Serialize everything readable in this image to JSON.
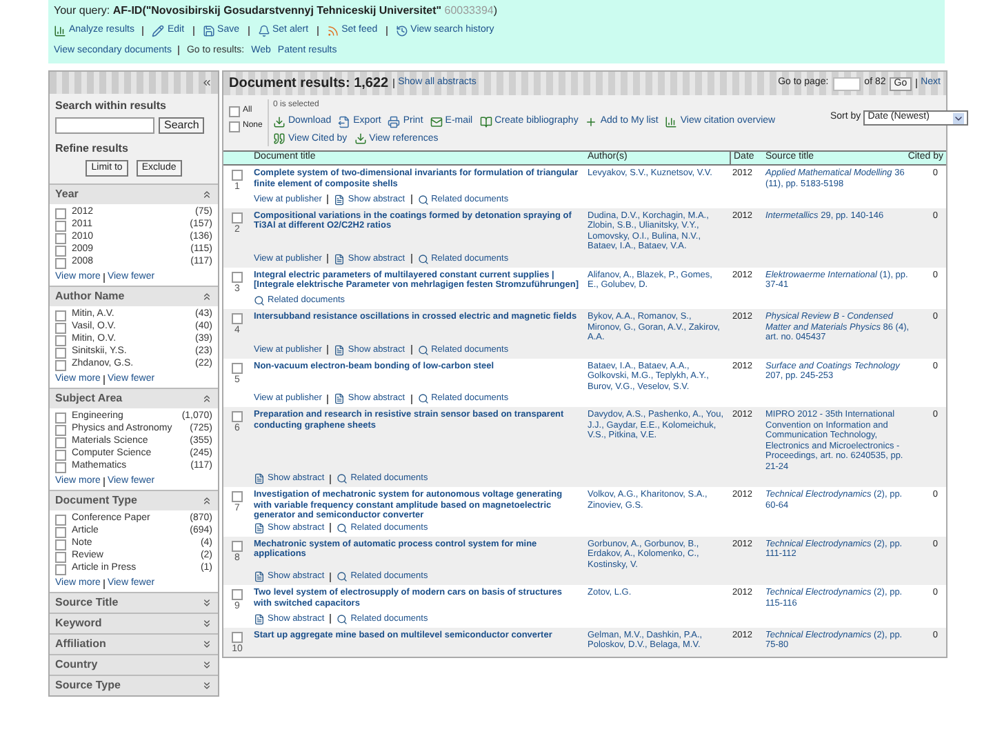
{
  "query": {
    "label": "Your query:",
    "text": "AF-ID(\"Novosibirskij Gosudarstvennyj Tehniceskij Universitet\" ",
    "id": "60033394",
    "close": ")"
  },
  "header_tools": [
    {
      "kind": "chart",
      "label": "Analyze results"
    },
    {
      "kind": "edit",
      "label": "Edit"
    },
    {
      "kind": "save",
      "label": "Save"
    },
    {
      "kind": "alert",
      "label": "Set alert"
    },
    {
      "kind": "feed",
      "label": "Set feed"
    },
    {
      "kind": "history",
      "label": "View search history"
    }
  ],
  "header_links": [
    {
      "label": "View secondary documents"
    },
    {
      "label": "Go to results:"
    },
    {
      "label": "Web"
    },
    {
      "label": "Patent results"
    }
  ],
  "sidebar": {
    "search_label": "Search within results",
    "search_button": "Search",
    "refine_label": "Refine results",
    "limit_button": "Limit to",
    "exclude_button": "Exclude",
    "facets": [
      {
        "title": "Year",
        "expanded": true,
        "items": [
          {
            "label": "2012",
            "count": "(75)",
            "checked": false
          },
          {
            "label": "2011",
            "count": "(157)",
            "checked": false
          },
          {
            "label": "2010",
            "count": "(136)",
            "checked": false
          },
          {
            "label": "2009",
            "count": "(115)",
            "checked": false
          },
          {
            "label": "2008",
            "count": "(117)",
            "checked": false
          }
        ],
        "more": "View more",
        "fewer": "View fewer"
      },
      {
        "title": "Author Name",
        "expanded": true,
        "items": [
          {
            "label": "Mitin, A.V.",
            "count": "(43)",
            "checked": false
          },
          {
            "label": "Vasil, O.V.",
            "count": "(40)",
            "checked": false
          },
          {
            "label": "Mitin, O.V.",
            "count": "(39)",
            "checked": false
          },
          {
            "label": "Sinitskii, Y.S.",
            "count": "(23)",
            "checked": false
          },
          {
            "label": "Zhdanov, G.S.",
            "count": "(22)",
            "checked": false
          }
        ],
        "more": "View more",
        "fewer": "View fewer"
      },
      {
        "title": "Subject Area",
        "expanded": true,
        "items": [
          {
            "label": "Engineering",
            "count": "(1,070)",
            "checked": false
          },
          {
            "label": "Physics and Astronomy",
            "count": "(725)",
            "checked": false
          },
          {
            "label": "Materials Science",
            "count": "(355)",
            "checked": false
          },
          {
            "label": "Computer Science",
            "count": "(245)",
            "checked": false
          },
          {
            "label": "Mathematics",
            "count": "(117)",
            "checked": false
          }
        ],
        "more": "View more",
        "fewer": "View fewer"
      },
      {
        "title": "Document Type",
        "expanded": true,
        "items": [
          {
            "label": "Conference Paper",
            "count": "(870)",
            "checked": false
          },
          {
            "label": "Article",
            "count": "(694)",
            "checked": false
          },
          {
            "label": "Note",
            "count": "(4)",
            "checked": false
          },
          {
            "label": "Review",
            "count": "(2)",
            "checked": false
          },
          {
            "label": "Article in Press",
            "count": "(1)",
            "checked": false
          }
        ],
        "more": "View more",
        "fewer": "View fewer"
      },
      {
        "title": "Source Title",
        "expanded": false
      },
      {
        "title": "Keyword",
        "expanded": false
      },
      {
        "title": "Affiliation",
        "expanded": false
      },
      {
        "title": "Country",
        "expanded": false
      },
      {
        "title": "Source Type",
        "expanded": false
      }
    ]
  },
  "results": {
    "title": "Document results: 1,622",
    "show_all": "Show all abstracts",
    "goto_label": "Go to page:",
    "of_pages": "of 82",
    "go_button": "Go",
    "next_link": "Next",
    "select_all": "All",
    "select_none": "None",
    "select_all_checked": false,
    "select_none_checked": false,
    "selected_count": "0 is selected",
    "actions": [
      {
        "kind": "download",
        "label": "Download"
      },
      {
        "kind": "export",
        "label": "Export"
      },
      {
        "kind": "print",
        "label": "Print"
      },
      {
        "kind": "email",
        "label": "E-mail"
      },
      {
        "kind": "biblio",
        "label": "Create bibliography"
      },
      {
        "kind": "add",
        "label": "Add to My list"
      },
      {
        "kind": "chart",
        "label": "View citation overview"
      },
      {
        "kind": "cited",
        "label": "View Cited by"
      },
      {
        "kind": "download",
        "label": "View references"
      }
    ],
    "sort_label": "Sort by",
    "sort_value": "Date (Newest)",
    "columns": [
      "Document title",
      "Author(s)",
      "Date",
      "Source title",
      "Cited by"
    ],
    "rows": [
      {
        "number": "1",
        "checked": false,
        "title": "Complete system of two-dimensional invariants for formulation of triangular finite element of composite shells",
        "authors": "Levyakov, S.V., Kuznetsov, V.V.",
        "date": "2012",
        "source": "*Applied Mathematical Modelling* 36 (11), pp. 5183-5198",
        "cited": "0",
        "links": [
          {
            "kind": "publisher",
            "label": "View at publisher"
          },
          {
            "kind": "abstract",
            "label": "Show abstract"
          },
          {
            "kind": "related",
            "label": "Related documents"
          }
        ]
      },
      {
        "number": "2",
        "checked": false,
        "title": "Compositional variations in the coatings formed by detonation spraying of Ti3Al at different O2/C2H2 ratios",
        "authors": "Dudina, D.V., Korchagin, M.A., Zlobin, S.B., Ulianitsky, V.Y., Lomovsky, O.I., Bulina, N.V., Bataev, I.A., Bataev, V.A.",
        "date": "2012",
        "source": "*Intermetallics* 29, pp. 140-146",
        "cited": "0",
        "links": [
          {
            "kind": "publisher",
            "label": "View at publisher"
          },
          {
            "kind": "abstract",
            "label": "Show abstract"
          },
          {
            "kind": "related",
            "label": "Related documents"
          }
        ]
      },
      {
        "number": "3",
        "checked": false,
        "title": "Integral electric parameters of multilayered constant current supplies | [Integrale elektrische Parameter von mehrlagigen festen Stromzuführungen]",
        "authors": "Alifanov, A., Blazek, P., Gomes, E., Golubev, D.",
        "date": "2012",
        "source": "*Elektrowaerme International* (1), pp. 37-41",
        "cited": "0",
        "links": [
          {
            "kind": "related",
            "label": "Related documents"
          }
        ]
      },
      {
        "number": "4",
        "checked": false,
        "title": "Intersubband resistance oscillations in crossed electric and magnetic fields",
        "authors": "Bykov, A.A., Romanov, S., Mironov, G., Goran, A.V., Zakirov, A.A.",
        "date": "2012",
        "source": "*Physical Review B - Condensed Matter and Materials Physics* 86 (4), art. no. 045437",
        "cited": "0",
        "links": [
          {
            "kind": "publisher",
            "label": "View at publisher"
          },
          {
            "kind": "abstract",
            "label": "Show abstract"
          },
          {
            "kind": "related",
            "label": "Related documents"
          }
        ]
      },
      {
        "number": "5",
        "checked": false,
        "title": "Non-vacuum electron-beam bonding of low-carbon steel",
        "authors": "Bataev, I.A., Bataev, A.A., Golkovski, M.G., Teplykh, A.Y., Burov, V.G., Veselov, S.V.",
        "date": "2012",
        "source": "*Surface and Coatings Technology* 207, pp. 245-253",
        "cited": "0",
        "links": [
          {
            "kind": "publisher",
            "label": "View at publisher"
          },
          {
            "kind": "abstract",
            "label": "Show abstract"
          },
          {
            "kind": "related",
            "label": "Related documents"
          }
        ]
      },
      {
        "number": "6",
        "checked": false,
        "title": "Preparation and research in resistive strain sensor based on transparent conducting graphene sheets",
        "authors": "Davydov, A.S., Pashenko, A., You, J.J., Gaydar, E.E., Kolomeichuk, V.S., Pitkina, V.E.",
        "date": "2012",
        "source": "MIPRO 2012 - 35th International Convention on Information and Communication Technology, Electronics and Microelectronics - Proceedings, art. no. 6240535, pp. 21-24",
        "cited": "0",
        "links": [
          {
            "kind": "abstract",
            "label": "Show abstract"
          },
          {
            "kind": "related",
            "label": "Related documents"
          }
        ]
      },
      {
        "number": "7",
        "checked": false,
        "title": "Investigation of mechatronic system for autonomous voltage generating with variable frequency constant amplitude based on magnetoelectric generator and semiconductor converter",
        "authors": "Volkov, A.G., Kharitonov, S.A., Zinoviev, G.S.",
        "date": "2012",
        "source": "*Technical Electrodynamics* (2), pp. 60-64",
        "cited": "0",
        "links": [
          {
            "kind": "abstract",
            "label": "Show abstract"
          },
          {
            "kind": "related",
            "label": "Related documents"
          }
        ]
      },
      {
        "number": "8",
        "checked": false,
        "title": "Mechatronic system of automatic process control system for mine applications",
        "authors": "Gorbunov, A., Gorbunov, B., Erdakov, A., Kolomenko, C., Kostinsky, V.",
        "date": "2012",
        "source": "*Technical Electrodynamics* (2), pp. 111-112",
        "cited": "0",
        "links": [
          {
            "kind": "abstract",
            "label": "Show abstract"
          },
          {
            "kind": "related",
            "label": "Related documents"
          }
        ]
      },
      {
        "number": "9",
        "checked": false,
        "title": "Two level system of electrosupply of modern cars on basis of structures with switched capacitors",
        "authors": "Zotov, L.G.",
        "date": "2012",
        "source": "*Technical Electrodynamics* (2), pp. 115-116",
        "cited": "0",
        "links": [
          {
            "kind": "abstract",
            "label": "Show abstract"
          },
          {
            "kind": "related",
            "label": "Related documents"
          }
        ]
      },
      {
        "number": "10",
        "checked": false,
        "title": "Start up aggregate mine based on multilevel semiconductor converter",
        "authors": "Gelman, M.V., Dashkin, P.A., Poloskov, D.V., Belaga, M.V.",
        "date": "2012",
        "source": "*Technical Electrodynamics* (2), pp. 75-80",
        "cited": "0",
        "links": []
      }
    ]
  }
}
